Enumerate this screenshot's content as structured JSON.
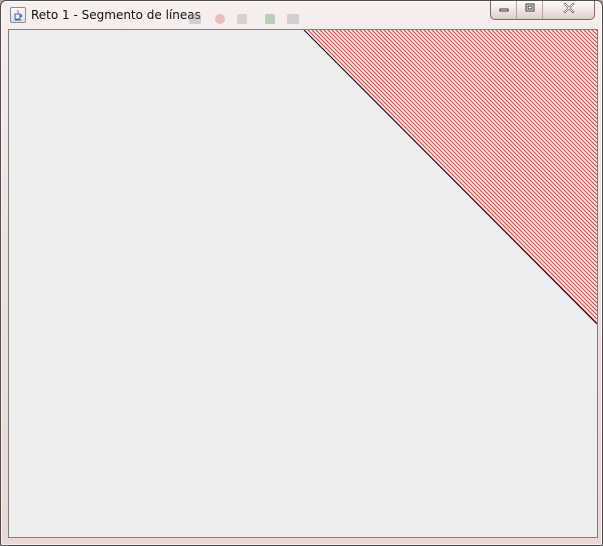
{
  "window": {
    "title": "Reto 1 - Segmento de líneas",
    "app_icon": "java-coffee-icon",
    "controls": {
      "minimize_icon": "minimize-icon",
      "maximize_icon": "maximize-icon",
      "close_icon": "close-icon"
    }
  },
  "canvas": {
    "background_color": "#eeeeee",
    "stroke_color": "#ff3333",
    "boundary_color": "#111111"
  }
}
